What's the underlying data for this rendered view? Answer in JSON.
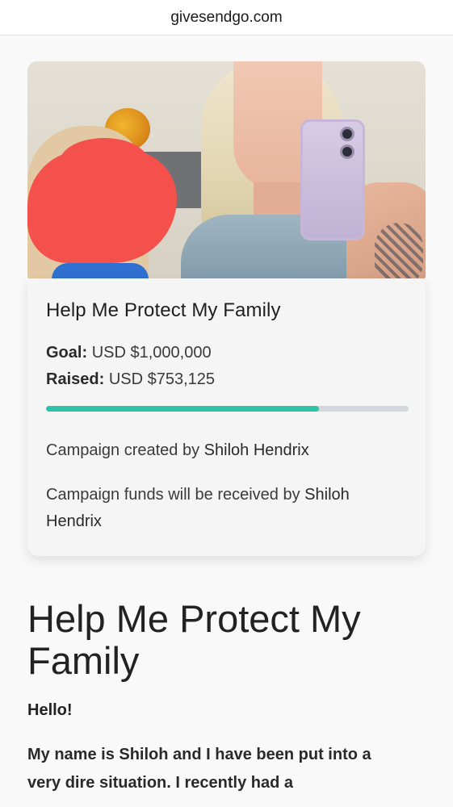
{
  "browser": {
    "url": "givesendgo.com"
  },
  "campaign": {
    "title": "Help Me Protect My Family",
    "goal_label": "Goal:",
    "goal_value": "USD $1,000,000",
    "raised_label": "Raised:",
    "raised_value": "USD $753,125",
    "progress_fraction": 0.753,
    "created_prefix": "Campaign created by",
    "creator": "Shiloh Hendrix",
    "funds_prefix": "Campaign funds will be received by",
    "recipient": "Shiloh Hendrix",
    "progress_color": "#2ec2a6"
  },
  "story": {
    "title": "Help Me Protect My Family",
    "greeting": "Hello!",
    "body": "My name is Shiloh and I have been put into a very dire situation. I recently had a"
  }
}
